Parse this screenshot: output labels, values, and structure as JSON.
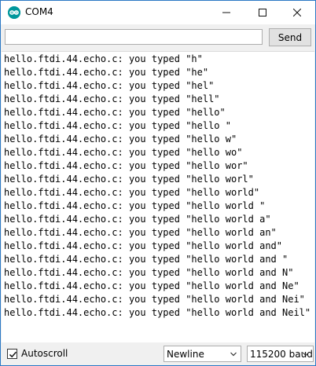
{
  "window": {
    "title": "COM4"
  },
  "titlebar": {
    "app_icon": "arduino-icon",
    "minimize_icon": "minimize-icon",
    "maximize_icon": "maximize-icon",
    "close_icon": "close-icon"
  },
  "send_row": {
    "input_value": "",
    "send_label": "Send"
  },
  "output": {
    "lines": [
      "hello.ftdi.44.echo.c: you typed \"h\"",
      "hello.ftdi.44.echo.c: you typed \"he\"",
      "hello.ftdi.44.echo.c: you typed \"hel\"",
      "hello.ftdi.44.echo.c: you typed \"hell\"",
      "hello.ftdi.44.echo.c: you typed \"hello\"",
      "hello.ftdi.44.echo.c: you typed \"hello \"",
      "hello.ftdi.44.echo.c: you typed \"hello w\"",
      "hello.ftdi.44.echo.c: you typed \"hello wo\"",
      "hello.ftdi.44.echo.c: you typed \"hello wor\"",
      "hello.ftdi.44.echo.c: you typed \"hello worl\"",
      "hello.ftdi.44.echo.c: you typed \"hello world\"",
      "hello.ftdi.44.echo.c: you typed \"hello world \"",
      "hello.ftdi.44.echo.c: you typed \"hello world a\"",
      "hello.ftdi.44.echo.c: you typed \"hello world an\"",
      "hello.ftdi.44.echo.c: you typed \"hello world and\"",
      "hello.ftdi.44.echo.c: you typed \"hello world and \"",
      "hello.ftdi.44.echo.c: you typed \"hello world and N\"",
      "hello.ftdi.44.echo.c: you typed \"hello world and Ne\"",
      "hello.ftdi.44.echo.c: you typed \"hello world and Nei\"",
      "hello.ftdi.44.echo.c: you typed \"hello world and Neil\""
    ]
  },
  "bottom_bar": {
    "autoscroll_label": "Autoscroll",
    "autoscroll_checked": true,
    "line_ending": "Newline",
    "baud_rate": "115200 baud"
  },
  "colors": {
    "app_icon": "#00979c",
    "window_border": "#2b78c5"
  }
}
